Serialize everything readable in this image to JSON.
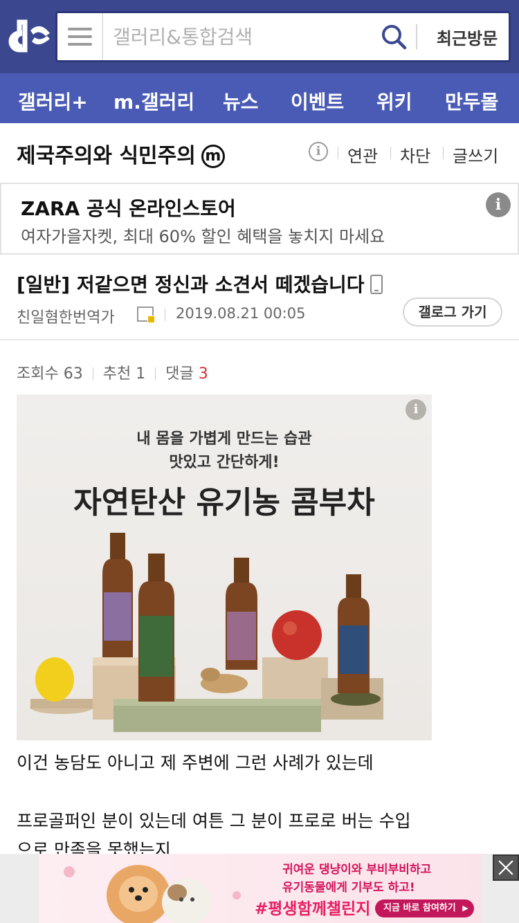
{
  "header": {
    "logo_icon": "dc-logo-icon",
    "menu_icon": "hamburger-icon",
    "search_placeholder": "갤러리&통합검색",
    "search_icon": "search-icon",
    "recent_label": "최근방문"
  },
  "nav": [
    "갤러리+",
    "m.갤러리",
    "뉴스",
    "이벤트",
    "위키",
    "만두몰"
  ],
  "gallery": {
    "title": "제국주의와 식민주의",
    "badge": "ⓜ",
    "tools": [
      "연관",
      "차단",
      "글쓰기"
    ]
  },
  "text_ad": {
    "title": "ZARA 공식 온라인스토어",
    "desc": "여자가을자켓, 최대 60% 할인 혜택을 놓치지 마세요"
  },
  "post": {
    "title": "[일반] 저같으면 정신과 소견서 떼겠습니다",
    "author": "친일혐한번역가",
    "date": "2019.08.21 00:05",
    "gallog_label": "갤로그 가기",
    "views_label": "조회수",
    "views": "63",
    "likes_label": "추천",
    "likes": "1",
    "comments_label": "댓글",
    "comments": "3",
    "body": [
      "이건 농담도 아니고 제 주변에 그런 사례가 있는데",
      "프로골퍼인 분이 있는데 여튼 그 분이 프로로 버는 수입",
      "으로 만족을 못했는지"
    ]
  },
  "image_ad": {
    "line1": "내 몸을 가볍게 만드는 습관",
    "line2": "맛있고 간단하게!",
    "headline": "자연탄산 유기농 콤부차"
  },
  "bottom_ad": {
    "line1": "귀여운 댕냥이와 부비부비하고",
    "line2": "유기동물에게 기부도 하고!",
    "tag": "#평생함께챌린지",
    "cta": "지금 바로 참여하기"
  },
  "colors": {
    "header_bg": "#3b4890",
    "nav_bg": "#4a5bb5",
    "comment_count": "#d32f2f"
  }
}
